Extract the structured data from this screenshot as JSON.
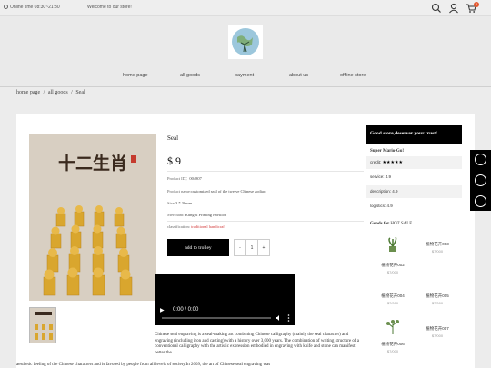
{
  "topbar": {
    "online_time": "Online time 08:30~21:30",
    "welcome": "Welcome to our store!",
    "cart_count": "0"
  },
  "nav": [
    "home page",
    "all goods",
    "payment",
    "about us",
    "offline store"
  ],
  "breadcrumb": [
    "home page",
    "/",
    "all goods",
    "/",
    "Seal"
  ],
  "product": {
    "title": "Seal",
    "price": "$ 9",
    "id_label": "Product ID",
    "id_value": "004807",
    "name_label": "Product name",
    "name_value": "customized seal of the twelve Chinese zodiac",
    "size_label": "Size",
    "size_value": "3 * 30mm",
    "merchant_label": "Merchant",
    "merchant_value": "Kungfu Printing Pavilion",
    "classification_label": "classification",
    "classification_value": "traditional handicraft",
    "add_to_trolley": "add to trolley",
    "qty_minus": "-",
    "qty_value": "1",
    "qty_plus": "+",
    "image_text": "十二生肖"
  },
  "video": {
    "play": "▶",
    "time": "0:00 / 0:00"
  },
  "description": {
    "para1": "Chinese seal engraving is a seal-making art combining Chinese calligraphy (mainly the seal character) and engraving (including iron and casting) with a history over 3,000 years. The combination of writing structure of a conventional calligraphy with the artistic expression embodied in engraving with knife and stone can manifest better the",
    "para2": "aesthetic feeling of the Chinese characters and is favored by people from all levels of society.In 2009,  the art of Chinese seal engraving was"
  },
  "sidebar": {
    "header": "Good store,deserver your trust!",
    "store_name": "Super Mario-Go!",
    "ratings": [
      {
        "label": "credit",
        "value": "★★★★★"
      },
      {
        "label": "service",
        "value": "4.9"
      },
      {
        "label": "description",
        "value": "4.9"
      },
      {
        "label": "logistics",
        "value": "4.9"
      }
    ],
    "goods_for": "Goods for",
    "hot_sale": "HOT SALE",
    "goods": [
      {
        "name": "植物花卉003",
        "price": "$7/000"
      },
      {
        "name": "植物花卉002",
        "price": "$7/000"
      },
      {
        "name": "植物花卉004",
        "price": "$7/000"
      },
      {
        "name": "植物花卉005",
        "price": "$7/000"
      },
      {
        "name": "植物花卉007",
        "price": "$7/000"
      },
      {
        "name": "植物花卉006",
        "price": "$7/000"
      }
    ]
  },
  "colors": {
    "accent": "#000000",
    "classification": "#d23b3b",
    "gold": "#d9a62e"
  }
}
